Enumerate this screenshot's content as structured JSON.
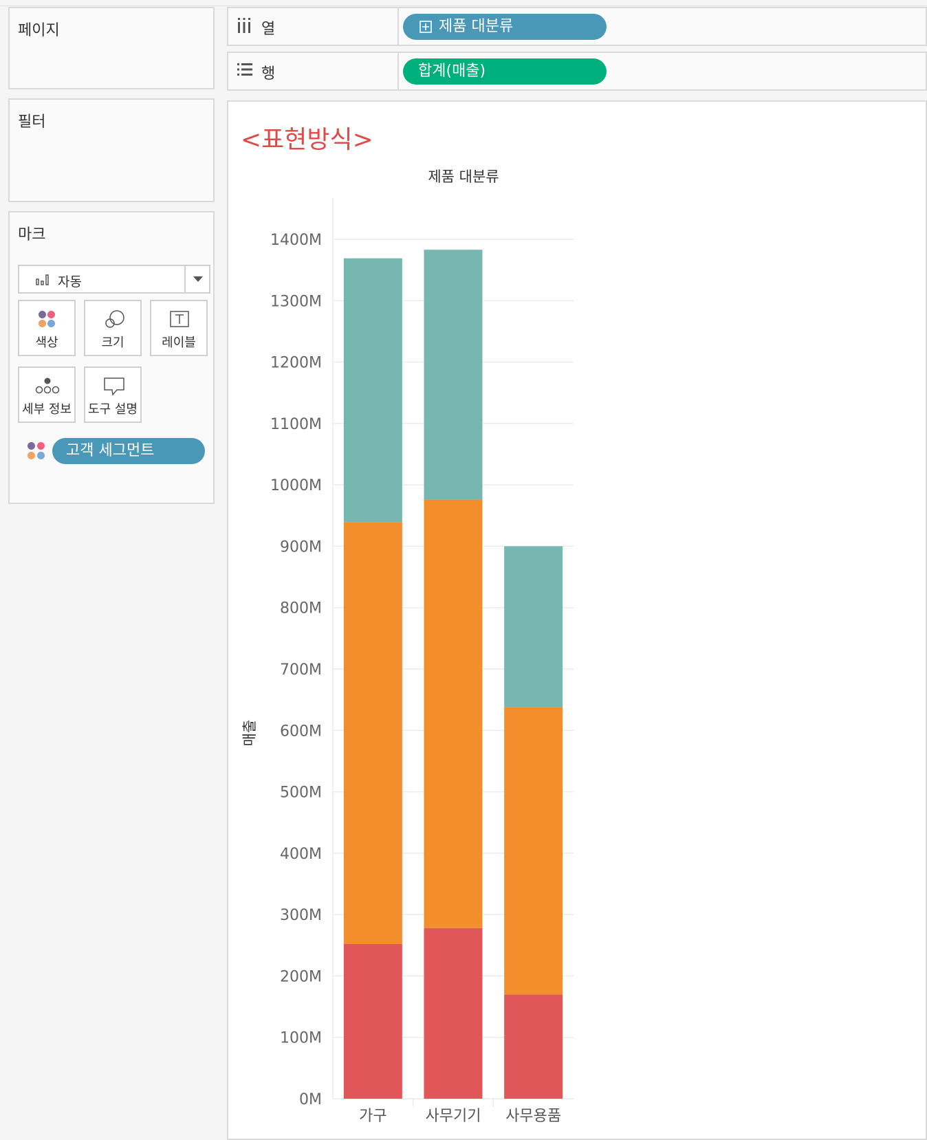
{
  "pages_panel": {
    "title": "페이지"
  },
  "filters_panel": {
    "title": "필터"
  },
  "marks_panel": {
    "title": "마크",
    "mark_type": "자동",
    "buttons": [
      {
        "label": "색상",
        "icon": "color-icon"
      },
      {
        "label": "크기",
        "icon": "size-icon"
      },
      {
        "label": "레이블",
        "icon": "label-icon"
      },
      {
        "label": "세부 정보",
        "icon": "detail-icon"
      },
      {
        "label": "도구 설명",
        "icon": "tooltip-icon"
      }
    ],
    "color_field": "고객 세그먼트"
  },
  "shelves": {
    "columns": {
      "label": "열",
      "pill": "제품 대분류",
      "pill_color": "#4a98b8"
    },
    "rows": {
      "label": "행",
      "pill": "합계(매출)",
      "pill_color": "#00b07c"
    }
  },
  "sheet": {
    "annotation": "<표현방식>",
    "annotation_color": "#e04a4a"
  },
  "colors": {
    "seg_1": "#e15759",
    "seg_2": "#f28e2b",
    "seg_3": "#76b7b2",
    "dots": [
      "#7b6b9d",
      "#f0607a",
      "#f4a261",
      "#7aa7d4"
    ]
  },
  "chart_data": {
    "type": "bar",
    "stacked": true,
    "title": "제품 대분류",
    "xlabel": "",
    "ylabel": "매출",
    "categories": [
      "가구",
      "사무기기",
      "사무용품"
    ],
    "series": [
      {
        "color": "#e15759",
        "values": [
          252,
          278,
          170
        ]
      },
      {
        "color": "#f28e2b",
        "values": [
          687,
          698,
          468
        ]
      },
      {
        "color": "#76b7b2",
        "values": [
          430,
          407,
          262
        ]
      }
    ],
    "yticks": [
      "0M",
      "100M",
      "200M",
      "300M",
      "400M",
      "500M",
      "600M",
      "700M",
      "800M",
      "900M",
      "1000M",
      "1100M",
      "1200M",
      "1300M",
      "1400M"
    ],
    "ylim": [
      0,
      1400
    ],
    "grid": true
  }
}
